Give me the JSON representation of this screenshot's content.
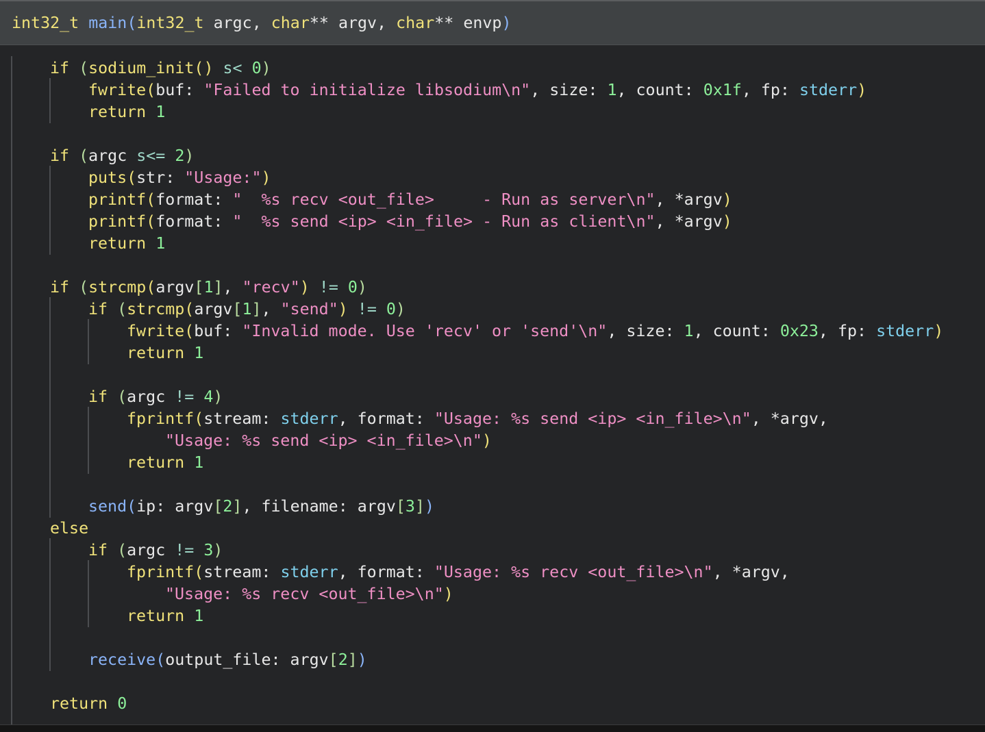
{
  "signature": {
    "return_type": "int32_t",
    "name": "main",
    "params": [
      {
        "type": "int32_t",
        "name": "argc"
      },
      {
        "type": "char",
        "ptr": "**",
        "name": "argv"
      },
      {
        "type": "char",
        "ptr": "**",
        "name": "envp"
      }
    ]
  },
  "strings": {
    "init_fail": "\"Failed to initialize libsodium\\n\"",
    "usage": "\"Usage:\"",
    "usage_recv": "\"  %s recv <out_file>     - Run as server\\n\"",
    "usage_send": "\"  %s send <ip> <in_file> - Run as client\\n\"",
    "recv": "\"recv\"",
    "send": "\"send\"",
    "invalid_mode": "\"Invalid mode. Use 'recv' or 'send'\\n\"",
    "send_usage": "\"Usage: %s send <ip> <in_file>\\n\"",
    "recv_usage": "\"Usage: %s recv <out_file>\\n\""
  },
  "numbers": {
    "zero": "0",
    "one": "1",
    "two": "2",
    "three": "3",
    "four": "4",
    "count_init": "0x1f",
    "count_invalid": "0x23"
  },
  "keywords": {
    "if": "if",
    "else": "else",
    "return": "return"
  },
  "functions": {
    "sodium_init": "sodium_init",
    "fwrite": "fwrite",
    "puts": "puts",
    "printf": "printf",
    "strcmp": "strcmp",
    "fprintf": "fprintf",
    "send": "send",
    "receive": "receive"
  },
  "globals": {
    "stderr": "stderr"
  },
  "colors": {
    "background": "#242527",
    "header": "#3f4244",
    "keyword": "#f0e27a",
    "function_call": "#8ab4f8",
    "string": "#ee8fc4",
    "number": "#8df09a",
    "global": "#7fd0ec",
    "text": "#e8e8e8"
  }
}
